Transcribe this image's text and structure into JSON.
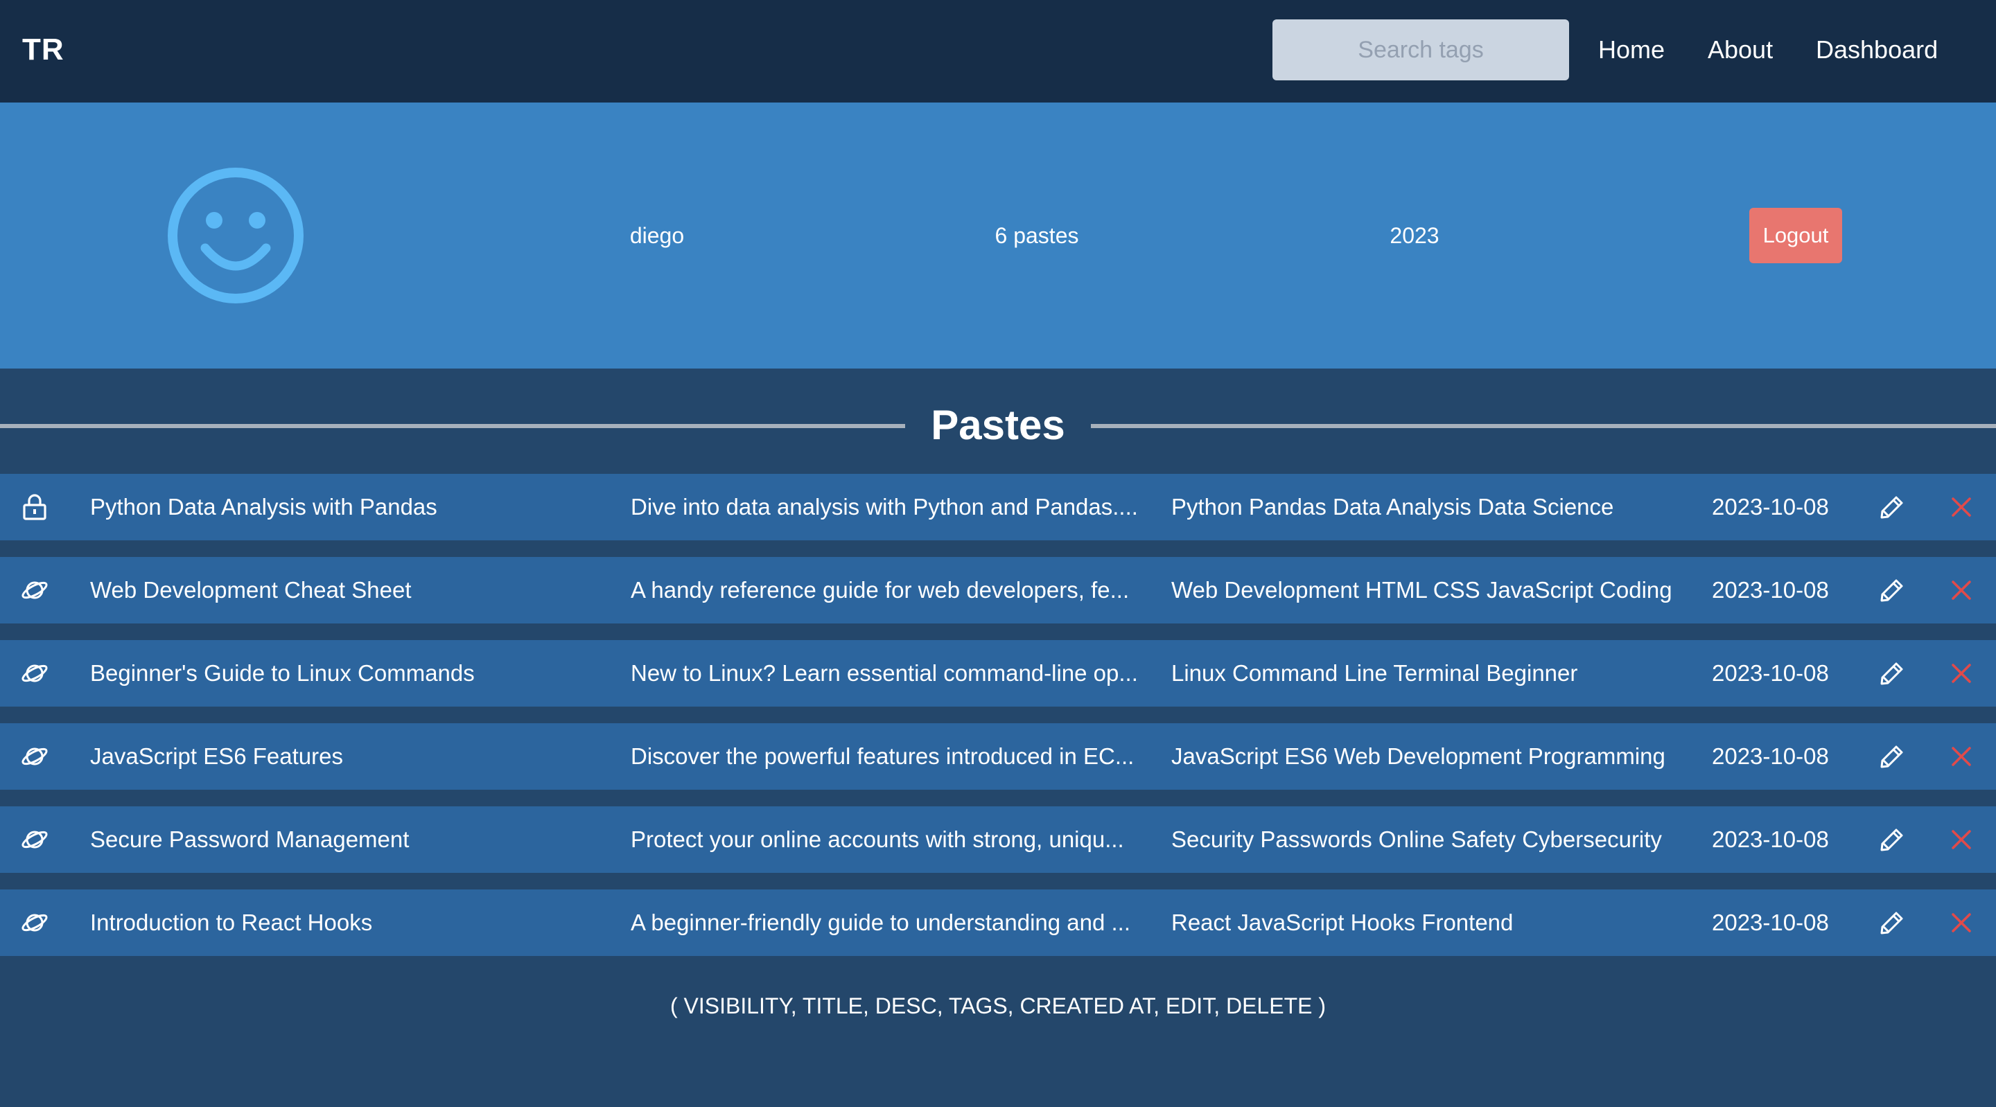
{
  "nav": {
    "logo": "TR",
    "search_placeholder": "Search tags",
    "links": [
      "Home",
      "About",
      "Dashboard"
    ]
  },
  "profile": {
    "avatar_icon": "smiley-face-icon",
    "username": "diego",
    "paste_count": "6 pastes",
    "year": "2023",
    "logout_label": "Logout"
  },
  "section": {
    "title": "Pastes"
  },
  "pastes": [
    {
      "visibility_icon": "lock-icon",
      "title": "Python Data Analysis with Pandas",
      "desc": "Dive into data analysis with Python and Pandas....",
      "tags": "Python Pandas Data Analysis Data Science",
      "created_at": "2023-10-08"
    },
    {
      "visibility_icon": "globe-icon",
      "title": "Web Development Cheat Sheet",
      "desc": "A handy reference guide for web developers, fe...",
      "tags": "Web Development HTML CSS JavaScript Coding",
      "created_at": "2023-10-08"
    },
    {
      "visibility_icon": "globe-icon",
      "title": "Beginner's Guide to Linux Commands",
      "desc": "New to Linux? Learn essential command-line op...",
      "tags": "Linux Command Line Terminal Beginner",
      "created_at": "2023-10-08"
    },
    {
      "visibility_icon": "globe-icon",
      "title": "JavaScript ES6 Features",
      "desc": "Discover the powerful features introduced in EC...",
      "tags": "JavaScript ES6 Web Development Programming",
      "created_at": "2023-10-08"
    },
    {
      "visibility_icon": "globe-icon",
      "title": "Secure Password Management",
      "desc": "Protect your online accounts with strong, uniqu...",
      "tags": "Security Passwords Online Safety Cybersecurity",
      "created_at": "2023-10-08"
    },
    {
      "visibility_icon": "globe-icon",
      "title": "Introduction to React Hooks",
      "desc": "A beginner-friendly guide to understanding and ...",
      "tags": "React JavaScript Hooks Frontend",
      "created_at": "2023-10-08"
    }
  ],
  "legend": "( VISIBILITY, TITLE, DESC, TAGS, CREATED AT, EDIT, DELETE )",
  "colors": {
    "nav_bg": "#162d48",
    "page_bg": "#24476b",
    "banner_bg": "#3a83c2",
    "row_bg": "#2c659e",
    "avatar": "#5bb8f5",
    "logout_bg": "#e8766f",
    "delete_icon": "#e24a4a"
  }
}
